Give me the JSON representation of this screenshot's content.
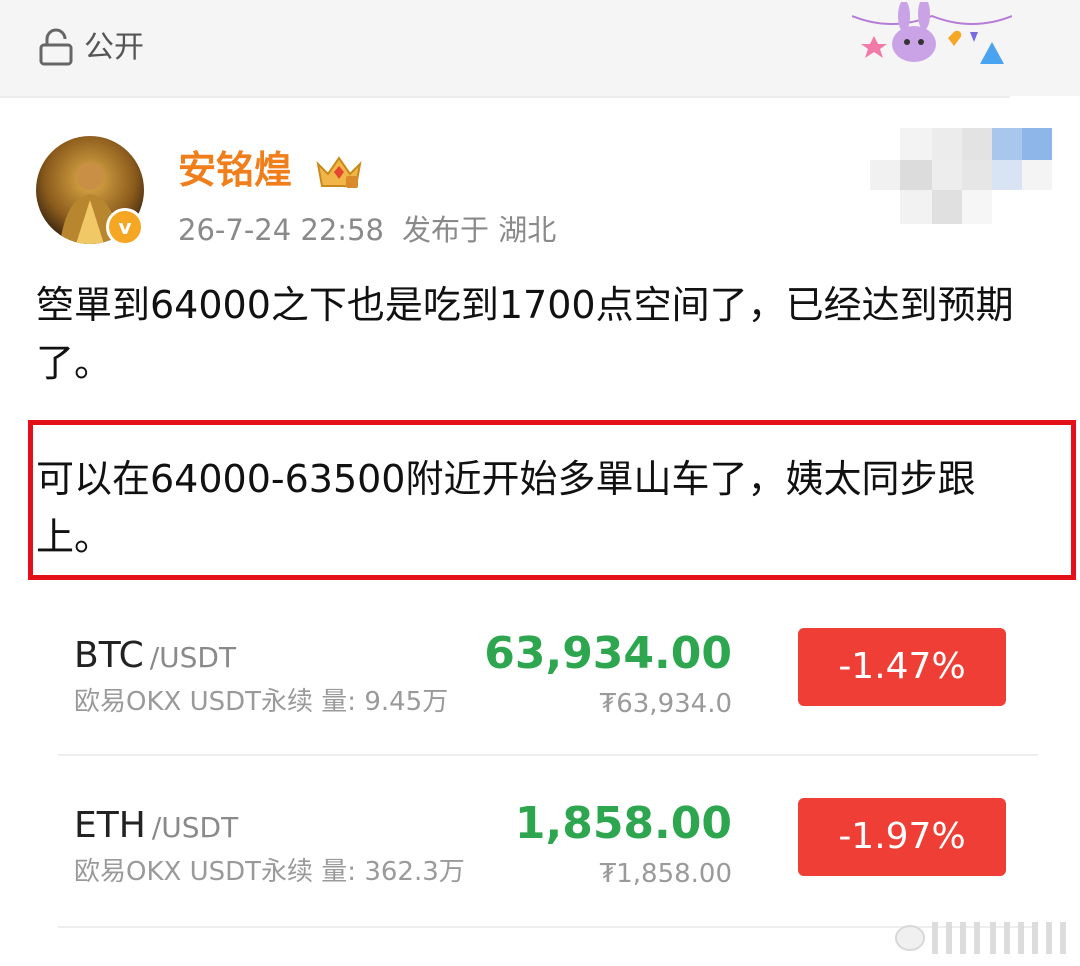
{
  "privacy": {
    "label": "公开",
    "icon": "lock-icon"
  },
  "post": {
    "author": {
      "name": "安铭煌",
      "badge_icon": "crown-vip-icon",
      "verified_mark": "v"
    },
    "time": "26-7-24 22:58",
    "location": "发布于 湖北",
    "paragraph1": "箜單到64000之下也是吃到1700点空间了，已经达到预期了。",
    "paragraph2": "可以在64000-63500附近开始多單山车了，姨太同步跟上。"
  },
  "tickers": [
    {
      "symbol": "BTC",
      "pair": "/USDT",
      "exchange": "欧易OKX USDT永续  量: 9.45万",
      "price": "63,934.00",
      "local_price": "₮63,934.0",
      "change": "-1.47%"
    },
    {
      "symbol": "ETH",
      "pair": "/USDT",
      "exchange": "欧易OKX USDT永续  量: 362.3万",
      "price": "1,858.00",
      "local_price": "₮1,858.00",
      "change": "-1.97%"
    }
  ],
  "colors": {
    "name": "#f07e1b",
    "price_up": "#2ea64f",
    "change_down": "#ee3e36",
    "highlight_border": "#e4101a"
  }
}
